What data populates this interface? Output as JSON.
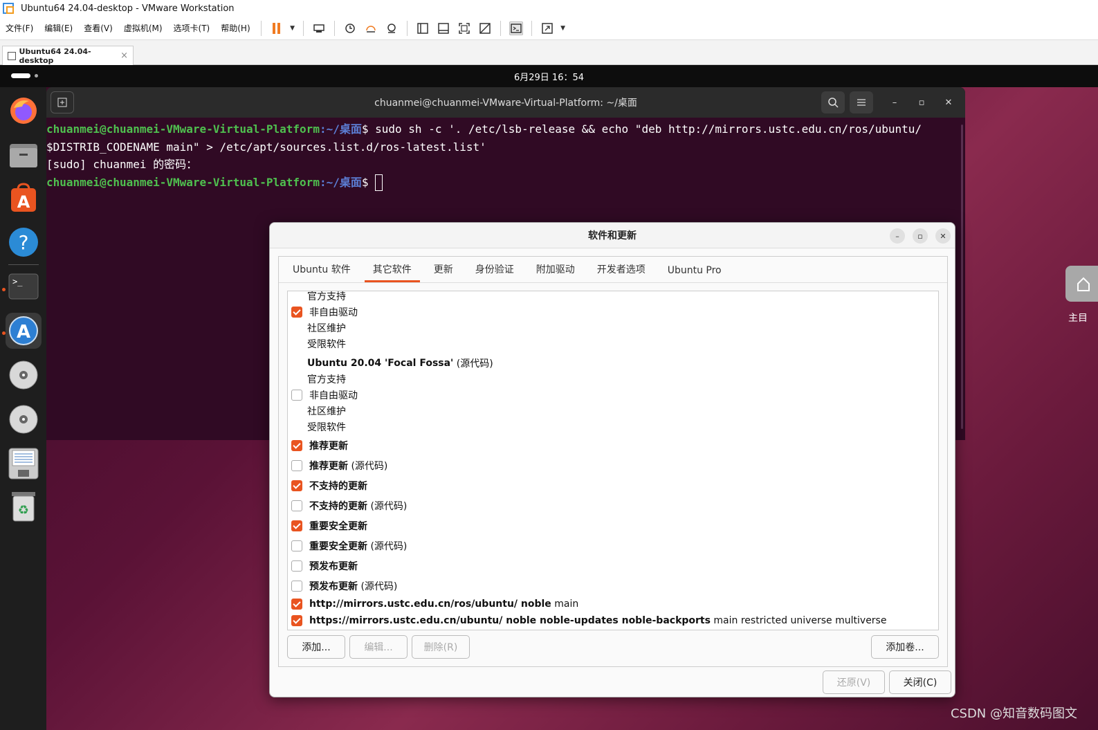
{
  "window_title": "Ubuntu64 24.04-desktop - VMware Workstation",
  "menu": [
    "文件(F)",
    "编辑(E)",
    "查看(V)",
    "虚拟机(M)",
    "选项卡(T)",
    "帮助(H)"
  ],
  "toolbar_icons": [
    "pause-icon",
    "chevron-down-icon",
    "send-ctrl-alt-del-icon",
    "snapshot-icon",
    "revert-snapshot-icon",
    "snapshot-manager-icon",
    "show-library-icon",
    "show-thumbnail-icon",
    "fullscreen-icon",
    "unity-icon",
    "console-view-icon",
    "stretch-icon",
    "chevron-down-icon"
  ],
  "vm_tab": {
    "label": "Ubuntu64 24.04-desktop",
    "close": "×"
  },
  "desktop": {
    "clock": "6月29日  16：54",
    "home_label": "主目"
  },
  "terminal": {
    "title": "chuanmei@chuanmei-VMware-Virtual-Platform: ~/桌面",
    "prompt_user": "chuanmei@chuanmei-VMware-Virtual-Platform",
    "prompt_path": ":~/桌面",
    "line1_cmd": "$ sudo sh -c '. /etc/lsb-release && echo \"deb http://mirrors.ustc.edu.cn/ros/ubuntu/",
    "line2": "$DISTRIB_CODENAME main\" > /etc/apt/sources.list.d/ros-latest.list'",
    "line3": "[sudo] chuanmei 的密码：",
    "line4_cmd": "$ "
  },
  "dialog": {
    "title": "软件和更新",
    "tabs": [
      "Ubuntu 软件",
      "其它软件",
      "更新",
      "身份验证",
      "附加驱动",
      "开发者选项",
      "Ubuntu Pro"
    ],
    "active_tab": 1,
    "rows": [
      {
        "checkbox": null,
        "text": "官方支持",
        "bold": "",
        "rest": ""
      },
      {
        "checkbox": true,
        "text": "非自由驱动",
        "bold": "",
        "rest": ""
      },
      {
        "checkbox": null,
        "text": "社区维护",
        "bold": "",
        "rest": ""
      },
      {
        "checkbox": null,
        "text": "受限软件",
        "bold": "",
        "rest": ""
      },
      {
        "checkbox": null,
        "text": "",
        "bold": "Ubuntu 20.04 'Focal Fossa'",
        "rest": " (源代码)"
      },
      {
        "checkbox": null,
        "text": "官方支持",
        "bold": "",
        "rest": ""
      },
      {
        "checkbox": false,
        "text": "非自由驱动",
        "bold": "",
        "rest": ""
      },
      {
        "checkbox": null,
        "text": "社区维护",
        "bold": "",
        "rest": ""
      },
      {
        "checkbox": null,
        "text": "受限软件",
        "bold": "",
        "rest": ""
      },
      {
        "checkbox": true,
        "text": "",
        "bold": "推荐更新",
        "rest": ""
      },
      {
        "checkbox": false,
        "text": "",
        "bold": "推荐更新",
        "rest": " (源代码)"
      },
      {
        "checkbox": true,
        "text": "",
        "bold": "不支持的更新",
        "rest": ""
      },
      {
        "checkbox": false,
        "text": "",
        "bold": "不支持的更新",
        "rest": " (源代码)"
      },
      {
        "checkbox": true,
        "text": "",
        "bold": "重要安全更新",
        "rest": ""
      },
      {
        "checkbox": false,
        "text": "",
        "bold": "重要安全更新",
        "rest": " (源代码)"
      },
      {
        "checkbox": false,
        "text": "",
        "bold": "预发布更新",
        "rest": ""
      },
      {
        "checkbox": false,
        "text": "",
        "bold": "预发布更新",
        "rest": " (源代码)"
      },
      {
        "checkbox": true,
        "text": "",
        "bold": "http://mirrors.ustc.edu.cn/ros/ubuntu/ noble",
        "rest": " main"
      },
      {
        "checkbox": true,
        "text": "",
        "bold": "https://mirrors.ustc.edu.cn/ubuntu/ noble noble-updates noble-backports",
        "rest": " main restricted universe multiverse"
      }
    ],
    "buttons": {
      "add": "添加...",
      "edit": "编辑...",
      "delete": "删除(R)",
      "add_volume": "添加卷...",
      "revert": "还原(V)",
      "close": "关闭(C)"
    }
  },
  "watermark": "CSDN @知音数码图文",
  "colors": {
    "accent": "#e95420",
    "terminal_bg": "#300a24",
    "prompt_user": "#4fc04f",
    "prompt_path": "#5c7fd6",
    "arrow": "#e8232a"
  }
}
